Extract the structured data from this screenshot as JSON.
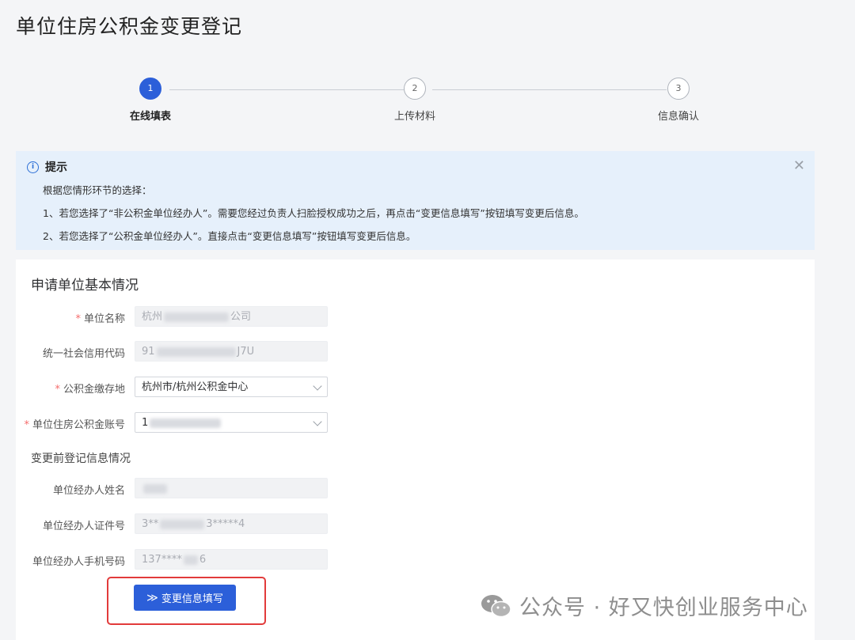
{
  "page": {
    "title": "单位住房公积金变更登记"
  },
  "steps": [
    {
      "num": "1",
      "label": "在线填表"
    },
    {
      "num": "2",
      "label": "上传材料"
    },
    {
      "num": "3",
      "label": "信息确认"
    }
  ],
  "alert": {
    "title": "提示",
    "lines": [
      "根据您情形环节的选择：",
      "1、若您选择了“非公积金单位经办人”。需要您经过负责人扫脸授权成功之后，再点击“变更信息填写”按钮填写变更后信息。",
      "2、若您选择了“公积金单位经办人”。直接点击“变更信息填写”按钮填写变更后信息。"
    ]
  },
  "form": {
    "section_title": "申请单位基本情况",
    "subsection_title": "变更前登记信息情况",
    "fields": {
      "unit_name": {
        "label": "单位名称",
        "value_start": "杭州",
        "value_end": "公司"
      },
      "credit_code": {
        "label": "统一社会信用代码",
        "value_start": "91",
        "value_end": "J7U"
      },
      "deposit_place": {
        "label": "公积金缴存地",
        "value": "杭州市/杭州公积金中心"
      },
      "account_no": {
        "label": "单位住房公积金账号",
        "value_start": "1"
      },
      "agent_name": {
        "label": "单位经办人姓名"
      },
      "agent_id": {
        "label": "单位经办人证件号",
        "value_start": "3**",
        "value_end": "3*****4"
      },
      "agent_phone": {
        "label": "单位经办人手机号码",
        "value_start": "137****",
        "value_end": "6"
      }
    },
    "submit_label": "变更信息填写"
  },
  "watermark": {
    "text": "公众号 · 好又快创业服务中心"
  },
  "colors": {
    "primary": "#2c5fd9",
    "alert_bg": "#e6f0fb",
    "required": "#f56c6c",
    "highlight": "#e23b3b"
  }
}
